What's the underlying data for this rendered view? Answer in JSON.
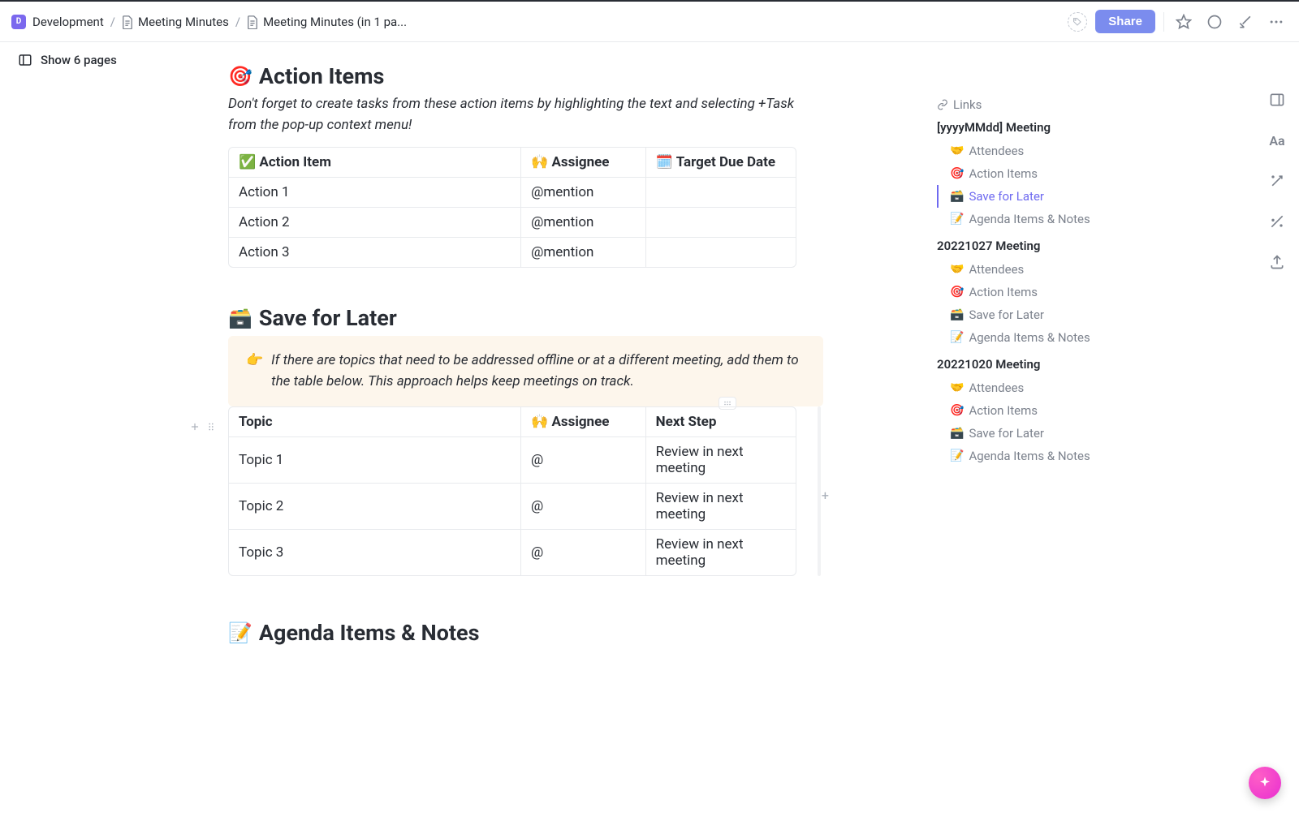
{
  "breadcrumb": {
    "root_badge": "D",
    "root": "Development",
    "mid": "Meeting Minutes",
    "leaf": "Meeting Minutes (in 1 pa..."
  },
  "topbar": {
    "share": "Share"
  },
  "left_rail": {
    "label": "Show 6 pages"
  },
  "action_items": {
    "emoji": "🎯",
    "title": "Action Items",
    "note": "Don't forget to create tasks from these action items by highlighting the text and selecting +Task from the pop-up context menu!",
    "cols": {
      "a_icon": "✅",
      "a": "Action Item",
      "b_icon": "🙌",
      "b": "Assignee",
      "c_icon": "🗓️",
      "c": "Target Due Date"
    },
    "rows": [
      {
        "a": "Action 1",
        "b": "@mention",
        "c": ""
      },
      {
        "a": "Action 2",
        "b": "@mention",
        "c": ""
      },
      {
        "a": "Action 3",
        "b": "@mention",
        "c": ""
      }
    ]
  },
  "save_later": {
    "emoji": "🗃️",
    "title": "Save for Later",
    "callout_icon": "👉",
    "callout": "If there are topics that need to be addressed offline or at a different meeting, add them to the table below. This approach helps keep meetings on track.",
    "cols": {
      "a": "Topic",
      "b_icon": "🙌",
      "b": "Assignee",
      "c": "Next Step"
    },
    "rows": [
      {
        "a": "Topic 1",
        "b": "@",
        "c": "Review in next meeting"
      },
      {
        "a": "Topic 2",
        "b": "@",
        "c": "Review in next meeting"
      },
      {
        "a": "Topic 3",
        "b": "@",
        "c": "Review in next meeting"
      }
    ]
  },
  "agenda": {
    "emoji": "📝",
    "title": "Agenda Items & Notes"
  },
  "outline": {
    "links": "Links",
    "sections": [
      {
        "title": "[yyyyMMdd] Meeting",
        "items": [
          {
            "icon": "🤝",
            "label": "Attendees",
            "active": false
          },
          {
            "icon": "🎯",
            "label": "Action Items",
            "active": false
          },
          {
            "icon": "🗃️",
            "label": "Save for Later",
            "active": true
          },
          {
            "icon": "📝",
            "label": "Agenda Items & Notes",
            "active": false
          }
        ]
      },
      {
        "title": "20221027 Meeting",
        "items": [
          {
            "icon": "🤝",
            "label": "Attendees",
            "active": false
          },
          {
            "icon": "🎯",
            "label": "Action Items",
            "active": false
          },
          {
            "icon": "🗃️",
            "label": "Save for Later",
            "active": false
          },
          {
            "icon": "📝",
            "label": "Agenda Items & Notes",
            "active": false
          }
        ]
      },
      {
        "title": "20221020 Meeting",
        "items": [
          {
            "icon": "🤝",
            "label": "Attendees",
            "active": false
          },
          {
            "icon": "🎯",
            "label": "Action Items",
            "active": false
          },
          {
            "icon": "🗃️",
            "label": "Save for Later",
            "active": false
          },
          {
            "icon": "📝",
            "label": "Agenda Items & Notes",
            "active": false
          }
        ]
      }
    ]
  }
}
